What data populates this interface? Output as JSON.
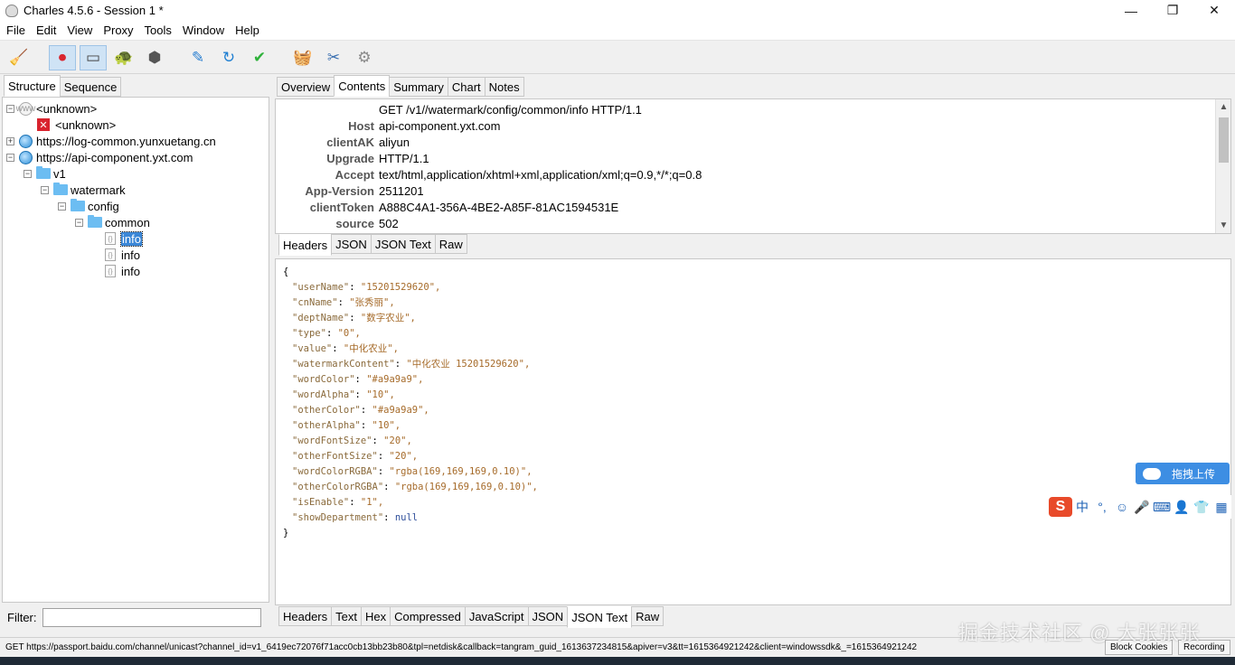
{
  "window": {
    "title": "Charles 4.5.6 - Session 1 *",
    "minimize": "—",
    "maximize": "❐",
    "close": "✕"
  },
  "menu": [
    "File",
    "Edit",
    "View",
    "Proxy",
    "Tools",
    "Window",
    "Help"
  ],
  "toolbar": [
    {
      "name": "broom-icon",
      "glyph": "🧹",
      "pressed": false
    },
    {
      "name": "record-icon",
      "glyph": "⏺",
      "pressed": true
    },
    {
      "name": "throttle-icon",
      "glyph": "▭",
      "pressed": true
    },
    {
      "name": "turtle-icon",
      "glyph": "🐢",
      "pressed": false
    },
    {
      "name": "stop-icon",
      "glyph": "⬢",
      "pressed": false
    },
    {
      "name": "pen-icon",
      "glyph": "✎",
      "pressed": false
    },
    {
      "name": "refresh-icon",
      "glyph": "↻",
      "pressed": false
    },
    {
      "name": "check-icon",
      "glyph": "✔",
      "pressed": false
    },
    {
      "name": "basket-icon",
      "glyph": "🧺",
      "pressed": false
    },
    {
      "name": "tools-icon",
      "glyph": "✂",
      "pressed": false
    },
    {
      "name": "gear-icon",
      "glyph": "⚙",
      "pressed": false
    }
  ],
  "left": {
    "tabs": [
      "Structure",
      "Sequence"
    ],
    "tree": [
      {
        "label": "<unknown>",
        "indent": 0,
        "icon": "globe-gray",
        "exp": "−"
      },
      {
        "label": "<unknown>",
        "indent": 1,
        "icon": "x",
        "exp": ""
      },
      {
        "label": "https://log-common.yunxuetang.cn",
        "indent": 0,
        "icon": "globe",
        "exp": "+"
      },
      {
        "label": "https://api-component.yxt.com",
        "indent": 0,
        "icon": "globe",
        "exp": "−"
      },
      {
        "label": "v1",
        "indent": 1,
        "icon": "folder",
        "exp": "−"
      },
      {
        "label": "watermark",
        "indent": 2,
        "icon": "folder",
        "exp": "−"
      },
      {
        "label": "config",
        "indent": 3,
        "icon": "folder",
        "exp": "−"
      },
      {
        "label": "common",
        "indent": 4,
        "icon": "folder",
        "exp": "−"
      },
      {
        "label": "info",
        "indent": 5,
        "icon": "doc",
        "exp": "",
        "selected": true
      },
      {
        "label": "info",
        "indent": 5,
        "icon": "doc",
        "exp": ""
      },
      {
        "label": "info",
        "indent": 5,
        "icon": "doc",
        "exp": ""
      }
    ],
    "filter_label": "Filter:"
  },
  "right": {
    "tabs": [
      "Overview",
      "Contents",
      "Summary",
      "Chart",
      "Notes"
    ],
    "active_tab": "Contents",
    "request_line": "GET /v1//watermark/config/common/info HTTP/1.1",
    "headers": [
      {
        "k": "Host",
        "v": "api-component.yxt.com"
      },
      {
        "k": "clientAK",
        "v": "aliyun"
      },
      {
        "k": "Upgrade",
        "v": "HTTP/1.1"
      },
      {
        "k": "Accept",
        "v": "text/html,application/xhtml+xml,application/xml;q=0.9,*/*;q=0.8"
      },
      {
        "k": "App-Version",
        "v": "2511201"
      },
      {
        "k": "clientToken",
        "v": "A888C4A1-356A-4BE2-A85F-81AC1594531E"
      },
      {
        "k": "source",
        "v": "502"
      }
    ],
    "subtabs": [
      "Headers",
      "JSON",
      "JSON Text",
      "Raw"
    ],
    "json_lines": [
      {
        "t": "{"
      },
      {
        "k": "\"userName\"",
        "v": "\"15201529620\","
      },
      {
        "k": "\"cnName\"",
        "v": "\"张秀丽\","
      },
      {
        "k": "\"deptName\"",
        "v": "\"数字农业\","
      },
      {
        "k": "\"type\"",
        "v": "\"0\","
      },
      {
        "k": "\"value\"",
        "v": "\"中化农业\","
      },
      {
        "k": "\"watermarkContent\"",
        "v": "\"中化农业 15201529620\","
      },
      {
        "k": "\"wordColor\"",
        "v": "\"#a9a9a9\","
      },
      {
        "k": "\"wordAlpha\"",
        "v": "\"10\","
      },
      {
        "k": "\"otherColor\"",
        "v": "\"#a9a9a9\","
      },
      {
        "k": "\"otherAlpha\"",
        "v": "\"10\","
      },
      {
        "k": "\"wordFontSize\"",
        "v": "\"20\","
      },
      {
        "k": "\"otherFontSize\"",
        "v": "\"20\","
      },
      {
        "k": "\"wordColorRGBA\"",
        "v": "\"rgba(169,169,169,0.10)\","
      },
      {
        "k": "\"otherColorRGBA\"",
        "v": "\"rgba(169,169,169,0.10)\","
      },
      {
        "k": "\"isEnable\"",
        "v": "\"1\","
      },
      {
        "k": "\"showDepartment\"",
        "v": "null",
        "null": true
      },
      {
        "t": "}"
      }
    ],
    "bottom_tabs": [
      "Headers",
      "Text",
      "Hex",
      "Compressed",
      "JavaScript",
      "JSON",
      "JSON Text",
      "Raw"
    ],
    "bottom_active": "JSON Text"
  },
  "status": {
    "url": "GET https://passport.baidu.com/channel/unicast?channel_id=v1_6419ec72076f71acc0cb13bb23b80&tpl=netdisk&callback=tangram_guid_1613637234815&apiver=v3&tt=1615364921242&client=windowssdk&_=1615364921242",
    "block_cookies": "Block Cookies",
    "recording": "Recording"
  },
  "upload_button": "拖拽上传",
  "ime": [
    "S",
    "中",
    "°,",
    "☺",
    "🎤",
    "⌨",
    "👤",
    "👕",
    "▦"
  ],
  "watermark": "掘金技术社区 @ 大张张张"
}
